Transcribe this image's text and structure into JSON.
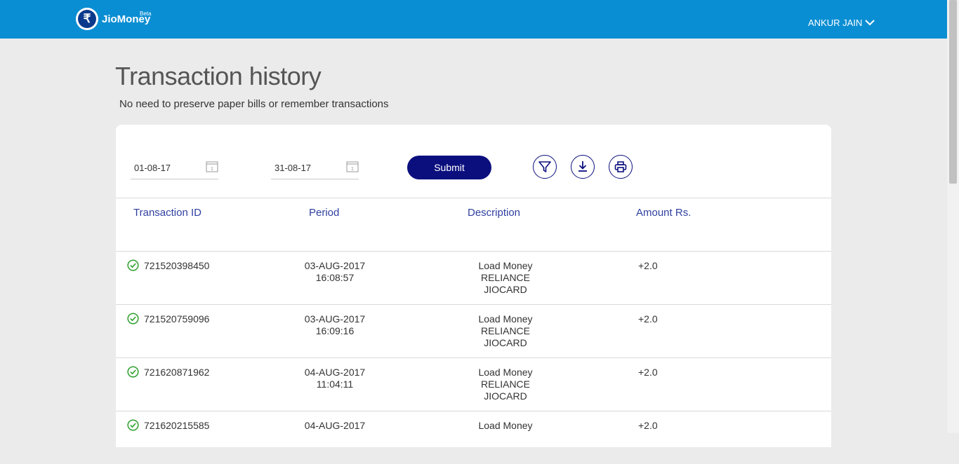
{
  "header": {
    "brand": "JioMoney",
    "beta": "Beta",
    "logo_symbol": "₹",
    "user_name": "ANKUR JAIN",
    "bg_color": "#0a8ed3"
  },
  "page": {
    "title": "Transaction history",
    "subtitle": "No need to preserve paper bills or remember transactions"
  },
  "filters": {
    "from_date": "01-08-17",
    "to_date": "31-08-17",
    "submit_label": "Submit",
    "icons": [
      "calendar-icon",
      "filter-icon",
      "download-icon",
      "print-icon"
    ],
    "accent_color": "#0b0f7e"
  },
  "table": {
    "columns": [
      "Transaction ID",
      "Period",
      "Description",
      "Amount Rs."
    ],
    "rows": [
      {
        "id": "721520398450",
        "date": "03-AUG-2017",
        "time": "16:08:57",
        "desc1": "Load Money",
        "desc2": "RELIANCE",
        "desc3": "JIOCARD",
        "amount": "+2.0",
        "status": "success"
      },
      {
        "id": "721520759096",
        "date": "03-AUG-2017",
        "time": "16:09:16",
        "desc1": "Load Money",
        "desc2": "RELIANCE",
        "desc3": "JIOCARD",
        "amount": "+2.0",
        "status": "success"
      },
      {
        "id": "721620871962",
        "date": "04-AUG-2017",
        "time": "11:04:11",
        "desc1": "Load Money",
        "desc2": "RELIANCE",
        "desc3": "JIOCARD",
        "amount": "+2.0",
        "status": "success"
      },
      {
        "id": "721620215585",
        "date": "04-AUG-2017",
        "time": "",
        "desc1": "Load Money",
        "desc2": "",
        "desc3": "",
        "amount": "+2.0",
        "status": "success"
      }
    ]
  }
}
